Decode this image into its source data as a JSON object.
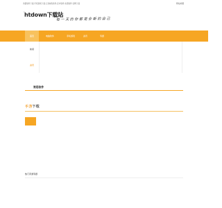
{
  "topbar": {
    "text": "海量软件下载,手机游戏下载,万款绿色软件,安卓软件,免费软件,官网下载",
    "link": "网站地图"
  },
  "logo": {
    "mark": "•",
    "text": "htdown下载站"
  },
  "slogan": "每 一 天 的 你 都 是 全 新 的 自 己",
  "nav": {
    "items": [
      {
        "label": "首页"
      },
      {
        "label": "电脑软件"
      },
      {
        "label": "手机游戏"
      },
      {
        "label": "资讯"
      },
      {
        "label": "专题"
      }
    ]
  },
  "panel": {
    "items": [
      {
        "label": "新闻"
      },
      {
        "label": "资讯"
      }
    ]
  },
  "section": {
    "title": "常用软件"
  },
  "news": {
    "accent": "手游",
    "title": "下载"
  },
  "hot": {
    "title": "热门手游专题"
  },
  "colors": {
    "accent": "#f6a623",
    "accent_text": "#f08c00"
  }
}
